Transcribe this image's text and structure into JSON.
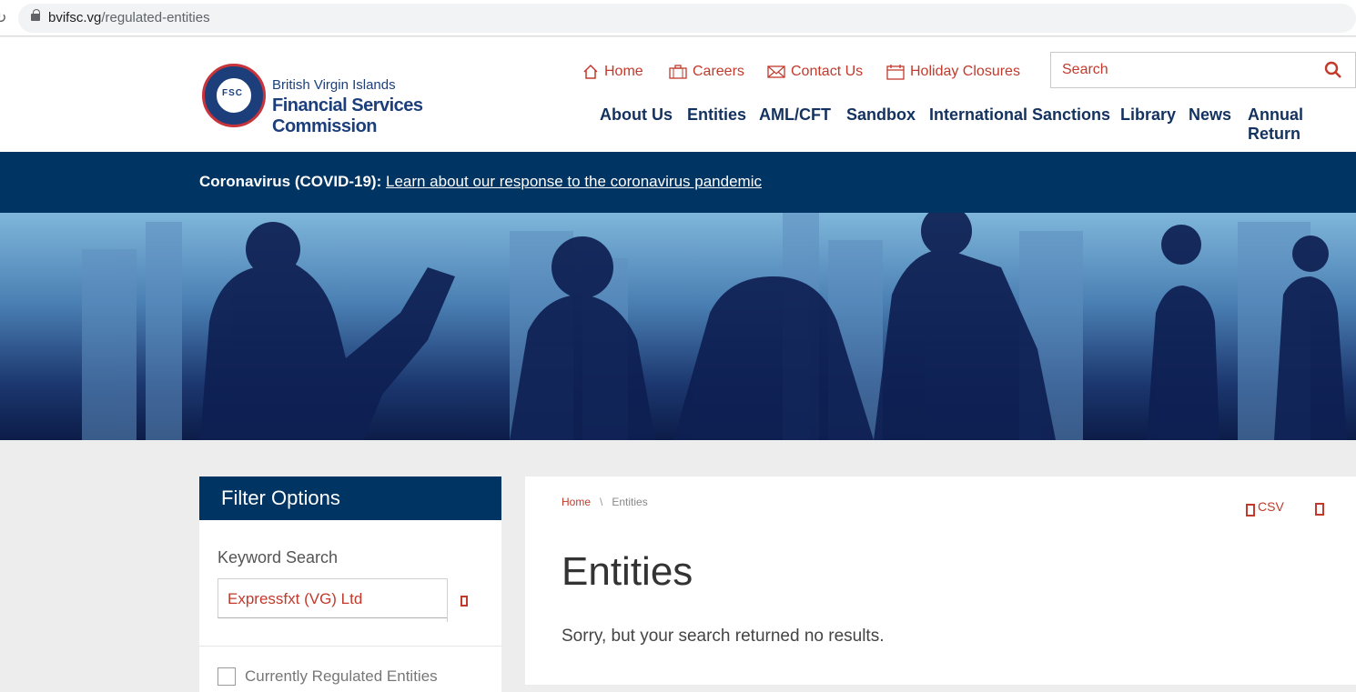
{
  "browser": {
    "url_domain": "bvifsc.vg",
    "url_path": "/regulated-entities"
  },
  "logo": {
    "seal_text": "FSC",
    "line1": "British Virgin Islands",
    "line2": "Financial Services Commission"
  },
  "utility_nav": [
    {
      "label": "Home",
      "icon": "home-icon"
    },
    {
      "label": "Careers",
      "icon": "briefcase-icon"
    },
    {
      "label": "Contact Us",
      "icon": "envelope-icon"
    },
    {
      "label": "Holiday Closures",
      "icon": "calendar-icon"
    }
  ],
  "search": {
    "placeholder": "Search",
    "icon": "search-icon"
  },
  "main_nav": [
    "About Us",
    "Entities",
    "AML/CFT",
    "Sandbox",
    "International Sanctions",
    "Library",
    "News",
    "Annual Return"
  ],
  "alert": {
    "label": "Coronavirus (COVID-19):",
    "link": "Learn about our response to the coronavirus pandemic"
  },
  "filter": {
    "title": "Filter Options",
    "keyword_label": "Keyword Search",
    "keyword_value": "Expressfxt (VG) Ltd",
    "checkbox_label": "Currently Regulated Entities"
  },
  "content": {
    "breadcrumb_home": "Home",
    "breadcrumb_sep": "\\",
    "breadcrumb_current": "Entities",
    "csv_label": "CSV",
    "title": "Entities",
    "message": "Sorry, but your search returned no results."
  },
  "colors": {
    "navy": "#003462",
    "accent_red": "#c13a2c",
    "nav_text": "#13325f"
  }
}
